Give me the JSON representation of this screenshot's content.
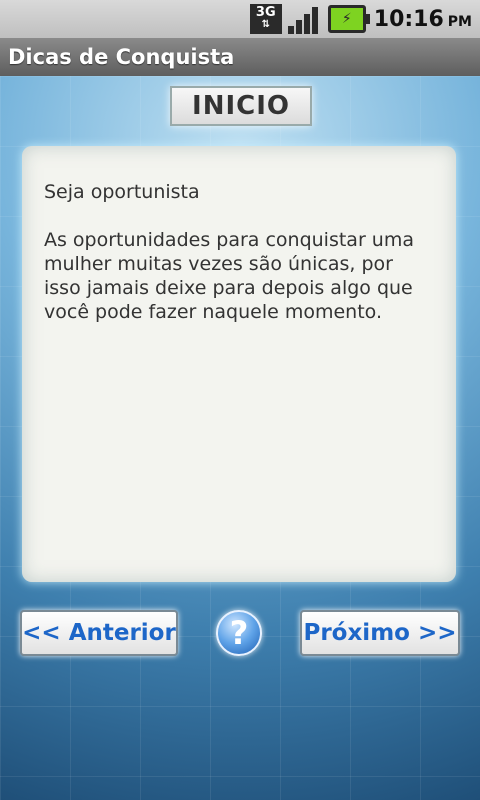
{
  "status_bar": {
    "network": "3G",
    "battery_icon": "battery-charging-icon",
    "time": "10:16",
    "ampm": "PM"
  },
  "app": {
    "title": "Dicas de Conquista"
  },
  "header": {
    "label": "INICIO"
  },
  "card": {
    "title": "Seja oportunista",
    "body": "As oportunidades para conquistar uma mulher muitas vezes são únicas, por isso jamais deixe para depois algo que você pode fazer naquele momento."
  },
  "buttons": {
    "previous": "<< Anterior",
    "help": "?",
    "next": "Próximo >>"
  },
  "colors": {
    "button_text": "#1d66c8",
    "background": "#4a8db9"
  }
}
